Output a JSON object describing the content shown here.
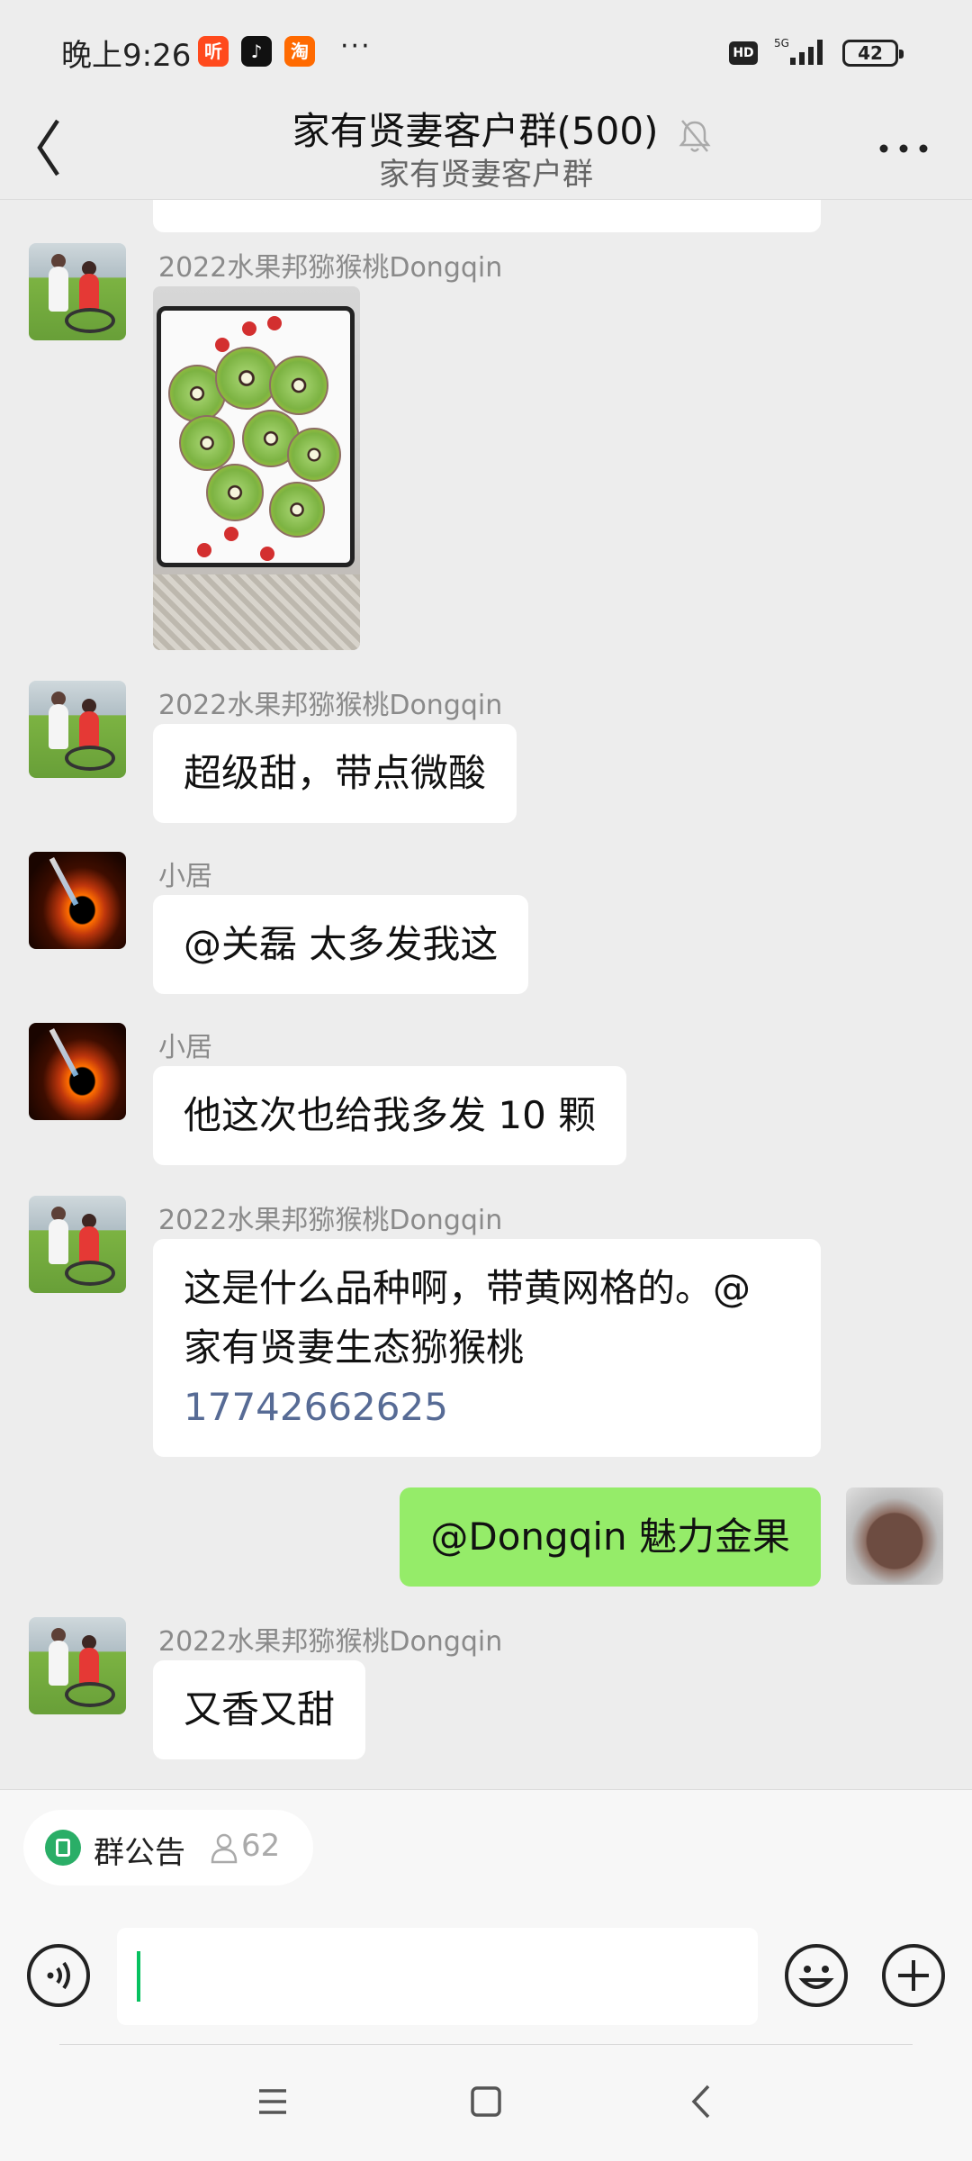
{
  "status_bar": {
    "time": "晚上9:26",
    "app_icons": [
      {
        "name": "ting-app-icon",
        "glyph": "听",
        "color": "#ff4a1d"
      },
      {
        "name": "tiktok-icon",
        "glyph": "♪",
        "color": "#111111"
      },
      {
        "name": "taobao-icon",
        "glyph": "淘",
        "color": "#ff6a00"
      }
    ],
    "more": "···",
    "hd": "HD",
    "network": "5G",
    "battery": "42"
  },
  "header": {
    "title": "家有贤妻客户群(500)",
    "subtitle": "家有贤妻客户群"
  },
  "messages": [
    {
      "sender": "2022水果邦猕猴桃Dongqin",
      "type": "image"
    },
    {
      "sender": "2022水果邦猕猴桃Dongqin",
      "text": "超级甜，带点微酸"
    },
    {
      "sender": "小居",
      "text": "@关磊  太多发我这"
    },
    {
      "sender": "小居",
      "text": "他这次也给我多发 10 颗"
    },
    {
      "sender": "2022水果邦猕猴桃Dongqin",
      "text_line1": "这是什么品种啊，带黄网格的。@",
      "text_line2": "家有贤妻生态猕猴桃",
      "phone": "17742662625"
    },
    {
      "sender": "me",
      "text": "@Dongqin  魅力金果"
    },
    {
      "sender": "2022水果邦猕猴桃Dongqin",
      "text": "又香又甜"
    }
  ],
  "notice": {
    "label": "群公告",
    "member_count": "62"
  },
  "colors": {
    "background": "#ededed",
    "my_bubble": "#95ec69",
    "link": "#576b95",
    "accent": "#07c160"
  }
}
